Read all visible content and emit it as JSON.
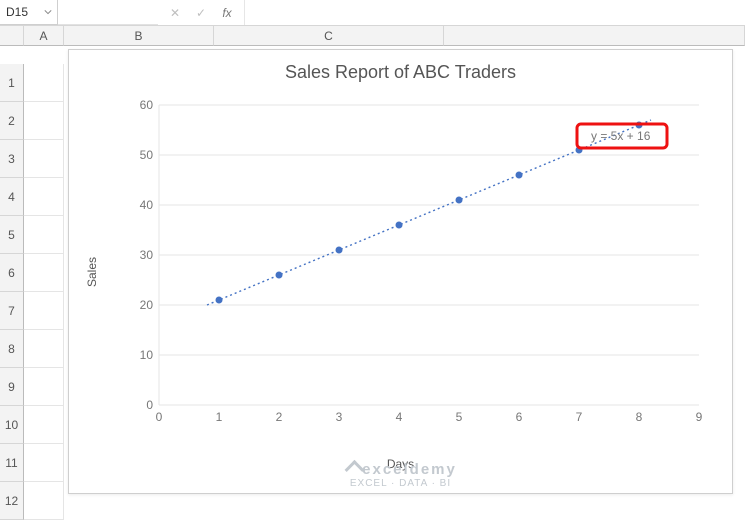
{
  "name_box": {
    "value": "D15"
  },
  "formula_bar": {
    "cancel": "✕",
    "confirm": "✓",
    "fx": "fx",
    "value": ""
  },
  "columns": [
    "A",
    "B",
    "C"
  ],
  "rows": [
    "1",
    "2",
    "3",
    "4",
    "5",
    "6",
    "7",
    "8",
    "9",
    "10",
    "11",
    "12"
  ],
  "chart_data": {
    "type": "scatter",
    "title": "Sales Report of ABC Traders",
    "xlabel": "Days",
    "ylabel": "Sales",
    "xlim": [
      0,
      9
    ],
    "ylim": [
      0,
      60
    ],
    "xticks": [
      0,
      1,
      2,
      3,
      4,
      5,
      6,
      7,
      8,
      9
    ],
    "yticks": [
      0,
      10,
      20,
      30,
      40,
      50,
      60
    ],
    "series": [
      {
        "name": "Sales",
        "x": [
          1,
          2,
          3,
          4,
          5,
          6,
          7,
          8
        ],
        "y": [
          21,
          26,
          31,
          36,
          41,
          46,
          51,
          56
        ]
      }
    ],
    "trendline": {
      "slope": 5,
      "intercept": 16,
      "equation": "y = 5x + 16"
    }
  },
  "watermark": {
    "line1": "exceldemy",
    "line2": "EXCEL · DATA · BI"
  },
  "colors": {
    "accent": "#4472C4",
    "highlight_border": "#ee1111"
  }
}
